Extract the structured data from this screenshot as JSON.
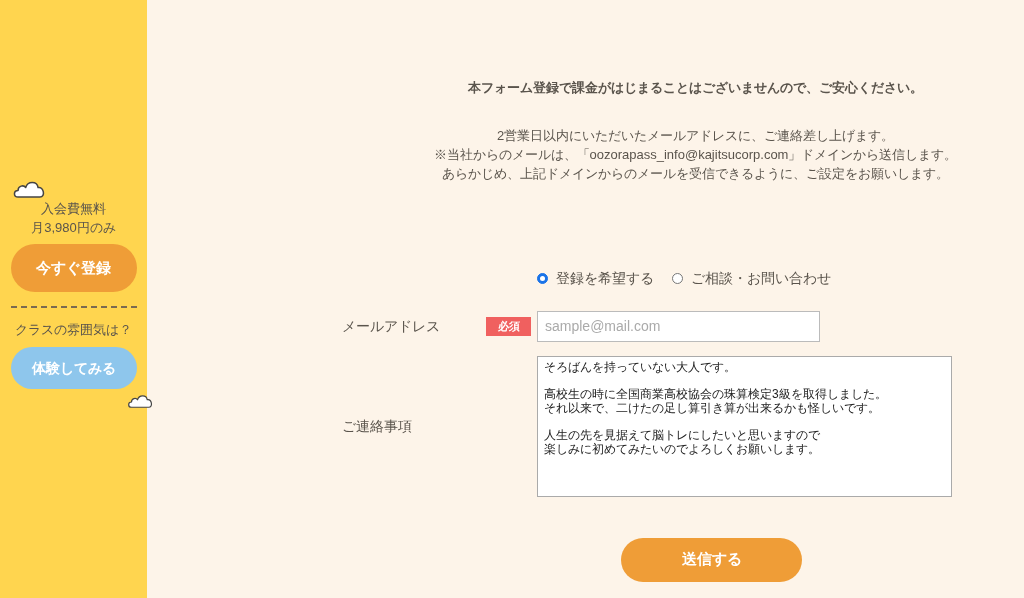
{
  "sidebar": {
    "fee_lines": [
      "入会費無料",
      "月3,980円のみ"
    ],
    "register_button": "今すぐ登録",
    "question": "クラスの雰囲気は？",
    "trial_button": "体験してみる"
  },
  "notice": "本フォーム登録で課金がはじまることはございませんので、ご安心ください。",
  "info_lines": [
    "2営業日以内にいただいたメールアドレスに、ご連絡差し上げます。",
    "※当社からのメールは、「oozorapass_info@kajitsucorp.com」ドメインから送信します。",
    "あらかじめ、上記ドメインからのメールを受信できるように、ご設定をお願いします。"
  ],
  "options": [
    {
      "label": "登録を希望する",
      "selected": true
    },
    {
      "label": "ご相談・お問い合わせ",
      "selected": false
    }
  ],
  "email": {
    "label": "メールアドレス",
    "badge": "必須",
    "placeholder": "sample@mail.com"
  },
  "message": {
    "label": "ご連絡事項",
    "paragraphs": [
      [
        "そろばんを持っていない大人です。"
      ],
      [
        "高校生の時に全国商業高校協会の珠算検定3級を取得しました。",
        "それ以来で、二けたの足し算引き算が出来るかも怪しいです。"
      ],
      [
        "人生の先を見据えて脳トレにしたいと思いますので",
        "楽しみに初めてみたいのでよろしくお願いします。"
      ]
    ]
  },
  "submit": "送信する"
}
